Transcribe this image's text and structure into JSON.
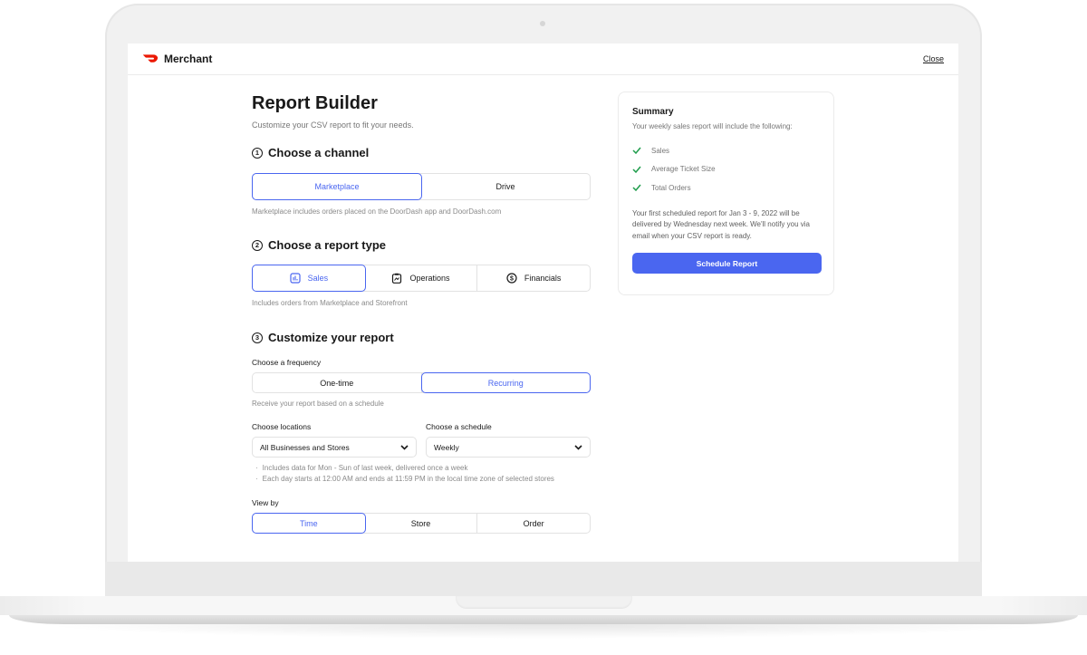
{
  "header": {
    "brand": "Merchant",
    "close_label": "Close"
  },
  "builder": {
    "title": "Report Builder",
    "subtitle": "Customize your CSV report to fit your needs.",
    "channel": {
      "step": "1",
      "heading": "Choose a channel",
      "options": [
        {
          "label": "Marketplace",
          "selected": true
        },
        {
          "label": "Drive",
          "selected": false
        }
      ],
      "helper": "Marketplace includes orders placed on the DoorDash app and DoorDash.com"
    },
    "report_type": {
      "step": "2",
      "heading": "Choose a report type",
      "options": [
        {
          "label": "Sales",
          "icon": "bar-chart-icon",
          "selected": true
        },
        {
          "label": "Operations",
          "icon": "clipboard-icon",
          "selected": false
        },
        {
          "label": "Financials",
          "icon": "dollar-circle-icon",
          "selected": false
        }
      ],
      "helper": "Includes orders from Marketplace and Storefront"
    },
    "customize": {
      "step": "3",
      "heading": "Customize your report",
      "frequency": {
        "label": "Choose a frequency",
        "options": [
          {
            "label": "One-time",
            "selected": false
          },
          {
            "label": "Recurring",
            "selected": true
          }
        ],
        "helper": "Receive your report based on a schedule"
      },
      "locations": {
        "label": "Choose locations",
        "value": "All Businesses and Stores"
      },
      "schedule": {
        "label": "Choose a schedule",
        "value": "Weekly"
      },
      "notes": [
        "Includes data for Mon - Sun of last week, delivered once a week",
        "Each day starts at 12:00 AM and ends at 11:59 PM in the local time zone of selected stores"
      ],
      "view_by": {
        "label": "View by",
        "options": [
          {
            "label": "Time",
            "selected": true
          },
          {
            "label": "Store",
            "selected": false
          },
          {
            "label": "Order",
            "selected": false
          }
        ]
      }
    }
  },
  "summary": {
    "title": "Summary",
    "intro": "Your weekly sales report will include the following:",
    "items": [
      "Sales",
      "Average Ticket Size",
      "Total Orders"
    ],
    "note": "Your first scheduled report for Jan 3 - 9, 2022 will be delivered by Wednesday next week. We'll notify you via email when your CSV report is ready.",
    "button_label": "Schedule Report"
  },
  "colors": {
    "accent": "#4a66f0",
    "brand_red": "#eb1700",
    "check_green": "#1f9d4c"
  }
}
